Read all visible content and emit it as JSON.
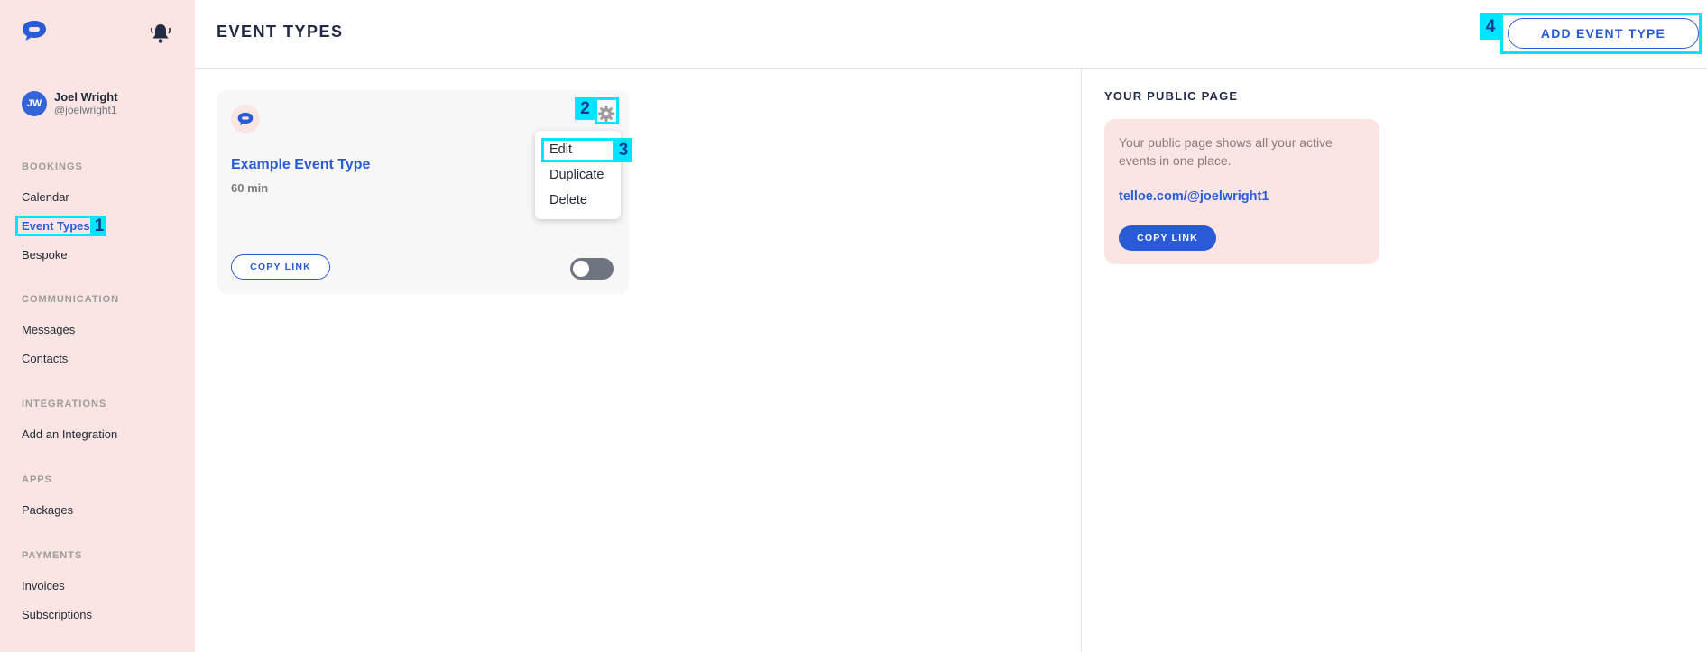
{
  "sidebar": {
    "user": {
      "initials": "JW",
      "name": "Joel Wright",
      "handle": "@joelwright1"
    },
    "sections": [
      {
        "title": "BOOKINGS",
        "items": [
          "Calendar",
          "Event Types",
          "Bespoke"
        ]
      },
      {
        "title": "COMMUNICATION",
        "items": [
          "Messages",
          "Contacts"
        ]
      },
      {
        "title": "INTEGRATIONS",
        "items": [
          "Add an Integration"
        ]
      },
      {
        "title": "APPS",
        "items": [
          "Packages"
        ]
      },
      {
        "title": "PAYMENTS",
        "items": [
          "Invoices",
          "Subscriptions"
        ]
      }
    ],
    "active_item": "Event Types"
  },
  "header": {
    "title": "EVENT TYPES",
    "add_button": "ADD EVENT TYPE"
  },
  "event_card": {
    "title": "Example Event Type",
    "duration": "60 min",
    "copy_link": "COPY LINK",
    "toggle_on": false
  },
  "settings_menu": {
    "items": [
      "Edit",
      "Duplicate",
      "Delete"
    ]
  },
  "public_page": {
    "title": "YOUR PUBLIC PAGE",
    "description": "Your public page shows all your active events in one place.",
    "link": "telloe.com/@joelwright1",
    "copy_link": "COPY LINK"
  },
  "markers": [
    "1",
    "2",
    "3",
    "4"
  ],
  "colors": {
    "accent": "#2a5bd7",
    "sidebar_bg": "#fbe5e2",
    "marker": "#00e5ff"
  }
}
